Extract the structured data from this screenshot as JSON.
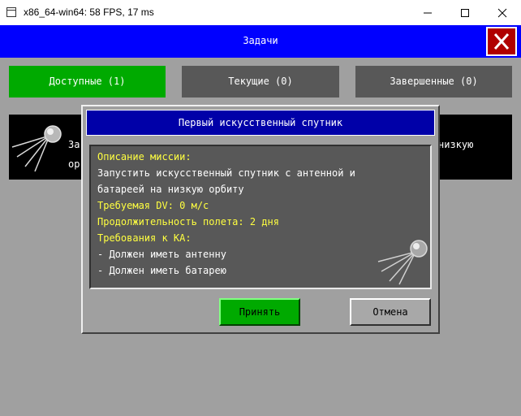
{
  "window": {
    "title": "x86_64-win64: 58 FPS, 17 ms"
  },
  "header": {
    "title": "Задачи"
  },
  "tabs": [
    {
      "label": "Доступные (1)",
      "color": "#00aa00"
    },
    {
      "label": "Текущие (0)",
      "color": "#585858"
    },
    {
      "label": "Завершенные (0)",
      "color": "#585858"
    }
  ],
  "mission_card": {
    "line1": "За",
    "line2": "ор",
    "right_text": "низкую"
  },
  "dialog": {
    "title": "Первый искусственный спутник",
    "lines": [
      {
        "text": "Описание миссии:",
        "highlight": true
      },
      {
        "text": "Запустить искусственный спутник с антенной и",
        "highlight": false
      },
      {
        "text": "батареей на низкую орбиту",
        "highlight": false
      },
      {
        "text": "Требуемая DV: 0 м/с",
        "highlight": true
      },
      {
        "text": "Продолжительность полета: 2 дня",
        "highlight": true
      },
      {
        "text": "Требования к КА:",
        "highlight": true
      },
      {
        "text": "- Должен иметь антенну",
        "highlight": false
      },
      {
        "text": "- Должен иметь батарею",
        "highlight": false
      }
    ],
    "accept_label": "Принять",
    "cancel_label": "Отмена"
  },
  "colors": {
    "header": "#0000ff",
    "dialog_title": "#0000a8",
    "highlight_text": "#ffff40",
    "accept": "#00aa00",
    "close": "#b00000"
  }
}
